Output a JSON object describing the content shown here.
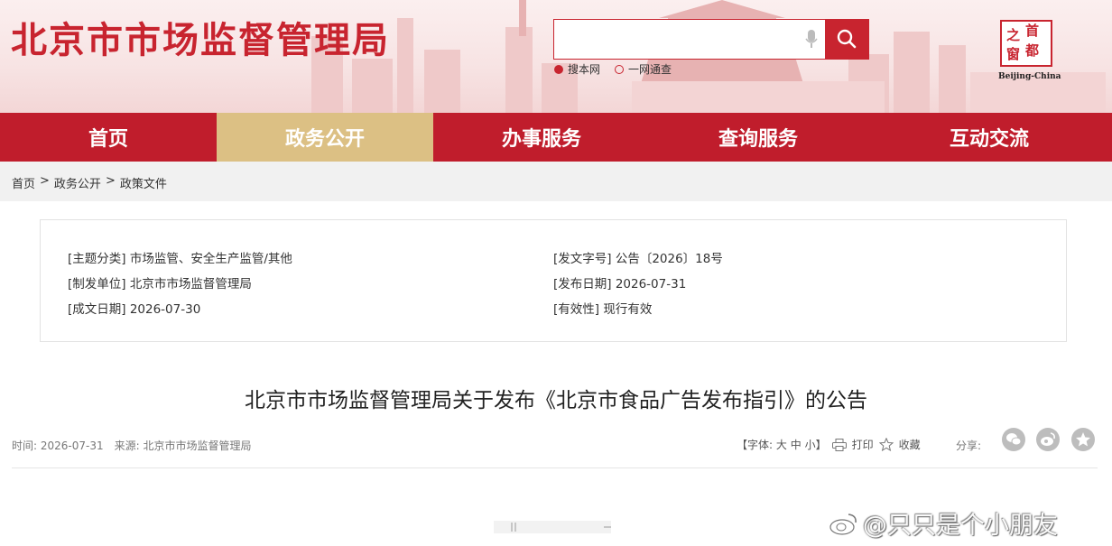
{
  "header": {
    "site_title": "北京市市场监督管理局",
    "search_placeholder": "",
    "search_options": [
      "搜本网",
      "一网通查"
    ],
    "logo_chars": [
      "之",
      "首",
      "都",
      "窗"
    ],
    "logo_sub": "Beijing-China"
  },
  "nav": {
    "items": [
      {
        "label": "首页",
        "active": false
      },
      {
        "label": "政务公开",
        "active": true
      },
      {
        "label": "办事服务",
        "active": false
      },
      {
        "label": "查询服务",
        "active": false
      },
      {
        "label": "互动交流",
        "active": false
      }
    ]
  },
  "breadcrumb": {
    "items": [
      "首页",
      "政务公开",
      "政策文件"
    ],
    "separator": ">"
  },
  "meta": {
    "topic": "[主题分类] 市场监管、安全生产监管/其他",
    "doc_no": "[发文字号] 公告〔2026〕18号",
    "issuer": "[制发单位] 北京市市场监督管理局",
    "publish_date": "[发布日期] 2026-07-31",
    "written_date": "[成文日期] 2026-07-30",
    "validity": "[有效性] 现行有效"
  },
  "article": {
    "title": "北京市市场监督管理局关于发布《北京市食品广告发布指引》的公告",
    "time": "时间: 2026-07-31",
    "source": "来源: 北京市市场监督管理局"
  },
  "tools": {
    "font_label": "【字体:",
    "font_large": "大",
    "font_medium": "中",
    "font_small": "小",
    "font_end": "】",
    "print": "打印",
    "favorite": "收藏",
    "share": "分享:"
  },
  "watermark": "@只只是个小朋友",
  "colors": {
    "brand": "#c01d2c",
    "active_tab": "#dcc084"
  }
}
